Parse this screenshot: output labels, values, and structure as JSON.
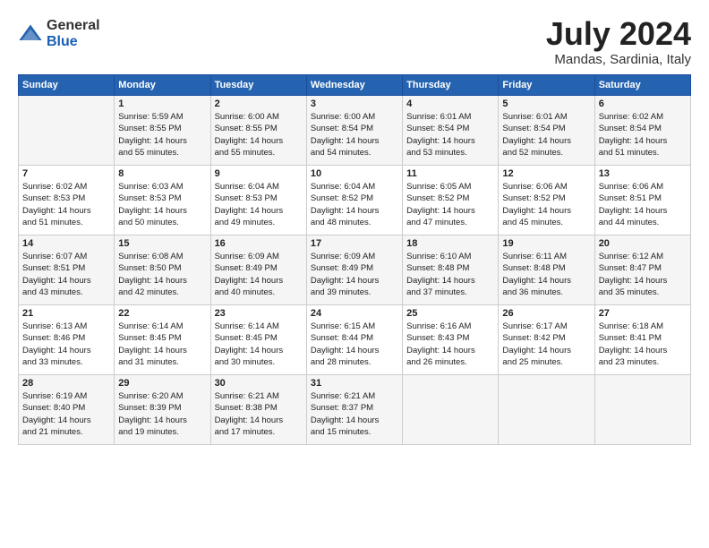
{
  "logo": {
    "general": "General",
    "blue": "Blue"
  },
  "title": "July 2024",
  "location": "Mandas, Sardinia, Italy",
  "headers": [
    "Sunday",
    "Monday",
    "Tuesday",
    "Wednesday",
    "Thursday",
    "Friday",
    "Saturday"
  ],
  "weeks": [
    [
      {
        "day": "",
        "info": ""
      },
      {
        "day": "1",
        "info": "Sunrise: 5:59 AM\nSunset: 8:55 PM\nDaylight: 14 hours\nand 55 minutes."
      },
      {
        "day": "2",
        "info": "Sunrise: 6:00 AM\nSunset: 8:55 PM\nDaylight: 14 hours\nand 55 minutes."
      },
      {
        "day": "3",
        "info": "Sunrise: 6:00 AM\nSunset: 8:54 PM\nDaylight: 14 hours\nand 54 minutes."
      },
      {
        "day": "4",
        "info": "Sunrise: 6:01 AM\nSunset: 8:54 PM\nDaylight: 14 hours\nand 53 minutes."
      },
      {
        "day": "5",
        "info": "Sunrise: 6:01 AM\nSunset: 8:54 PM\nDaylight: 14 hours\nand 52 minutes."
      },
      {
        "day": "6",
        "info": "Sunrise: 6:02 AM\nSunset: 8:54 PM\nDaylight: 14 hours\nand 51 minutes."
      }
    ],
    [
      {
        "day": "7",
        "info": "Sunrise: 6:02 AM\nSunset: 8:53 PM\nDaylight: 14 hours\nand 51 minutes."
      },
      {
        "day": "8",
        "info": "Sunrise: 6:03 AM\nSunset: 8:53 PM\nDaylight: 14 hours\nand 50 minutes."
      },
      {
        "day": "9",
        "info": "Sunrise: 6:04 AM\nSunset: 8:53 PM\nDaylight: 14 hours\nand 49 minutes."
      },
      {
        "day": "10",
        "info": "Sunrise: 6:04 AM\nSunset: 8:52 PM\nDaylight: 14 hours\nand 48 minutes."
      },
      {
        "day": "11",
        "info": "Sunrise: 6:05 AM\nSunset: 8:52 PM\nDaylight: 14 hours\nand 47 minutes."
      },
      {
        "day": "12",
        "info": "Sunrise: 6:06 AM\nSunset: 8:52 PM\nDaylight: 14 hours\nand 45 minutes."
      },
      {
        "day": "13",
        "info": "Sunrise: 6:06 AM\nSunset: 8:51 PM\nDaylight: 14 hours\nand 44 minutes."
      }
    ],
    [
      {
        "day": "14",
        "info": "Sunrise: 6:07 AM\nSunset: 8:51 PM\nDaylight: 14 hours\nand 43 minutes."
      },
      {
        "day": "15",
        "info": "Sunrise: 6:08 AM\nSunset: 8:50 PM\nDaylight: 14 hours\nand 42 minutes."
      },
      {
        "day": "16",
        "info": "Sunrise: 6:09 AM\nSunset: 8:49 PM\nDaylight: 14 hours\nand 40 minutes."
      },
      {
        "day": "17",
        "info": "Sunrise: 6:09 AM\nSunset: 8:49 PM\nDaylight: 14 hours\nand 39 minutes."
      },
      {
        "day": "18",
        "info": "Sunrise: 6:10 AM\nSunset: 8:48 PM\nDaylight: 14 hours\nand 37 minutes."
      },
      {
        "day": "19",
        "info": "Sunrise: 6:11 AM\nSunset: 8:48 PM\nDaylight: 14 hours\nand 36 minutes."
      },
      {
        "day": "20",
        "info": "Sunrise: 6:12 AM\nSunset: 8:47 PM\nDaylight: 14 hours\nand 35 minutes."
      }
    ],
    [
      {
        "day": "21",
        "info": "Sunrise: 6:13 AM\nSunset: 8:46 PM\nDaylight: 14 hours\nand 33 minutes."
      },
      {
        "day": "22",
        "info": "Sunrise: 6:14 AM\nSunset: 8:45 PM\nDaylight: 14 hours\nand 31 minutes."
      },
      {
        "day": "23",
        "info": "Sunrise: 6:14 AM\nSunset: 8:45 PM\nDaylight: 14 hours\nand 30 minutes."
      },
      {
        "day": "24",
        "info": "Sunrise: 6:15 AM\nSunset: 8:44 PM\nDaylight: 14 hours\nand 28 minutes."
      },
      {
        "day": "25",
        "info": "Sunrise: 6:16 AM\nSunset: 8:43 PM\nDaylight: 14 hours\nand 26 minutes."
      },
      {
        "day": "26",
        "info": "Sunrise: 6:17 AM\nSunset: 8:42 PM\nDaylight: 14 hours\nand 25 minutes."
      },
      {
        "day": "27",
        "info": "Sunrise: 6:18 AM\nSunset: 8:41 PM\nDaylight: 14 hours\nand 23 minutes."
      }
    ],
    [
      {
        "day": "28",
        "info": "Sunrise: 6:19 AM\nSunset: 8:40 PM\nDaylight: 14 hours\nand 21 minutes."
      },
      {
        "day": "29",
        "info": "Sunrise: 6:20 AM\nSunset: 8:39 PM\nDaylight: 14 hours\nand 19 minutes."
      },
      {
        "day": "30",
        "info": "Sunrise: 6:21 AM\nSunset: 8:38 PM\nDaylight: 14 hours\nand 17 minutes."
      },
      {
        "day": "31",
        "info": "Sunrise: 6:21 AM\nSunset: 8:37 PM\nDaylight: 14 hours\nand 15 minutes."
      },
      {
        "day": "",
        "info": ""
      },
      {
        "day": "",
        "info": ""
      },
      {
        "day": "",
        "info": ""
      }
    ]
  ]
}
